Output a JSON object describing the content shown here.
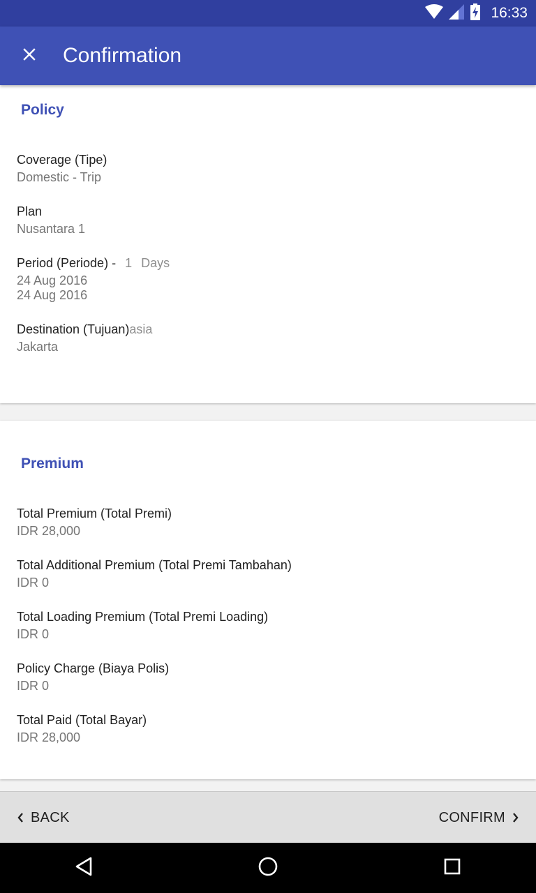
{
  "status_bar": {
    "time": "16:33"
  },
  "app_bar": {
    "title": "Confirmation"
  },
  "policy": {
    "title": "Policy",
    "coverage": {
      "label": "Coverage (Tipe)",
      "value": "Domestic - Trip"
    },
    "plan": {
      "label": "Plan",
      "value": "Nusantara 1"
    },
    "period": {
      "label": "Period (Periode) -",
      "days_count": "1",
      "days_unit": "Days",
      "start_date": "24 Aug 2016",
      "end_date": "24 Aug 2016"
    },
    "destination": {
      "label": "Destination (Tujuan)",
      "region": "asia",
      "value": "Jakarta"
    }
  },
  "premium": {
    "title": "Premium",
    "items": [
      {
        "label": "Total Premium (Total Premi)",
        "value": "IDR 28,000"
      },
      {
        "label": "Total Additional Premium (Total Premi Tambahan)",
        "value": "IDR 0"
      },
      {
        "label": "Total Loading Premium (Total Premi Loading)",
        "value": "IDR 0"
      },
      {
        "label": "Policy Charge (Biaya Polis)",
        "value": "IDR 0"
      },
      {
        "label": "Total Paid (Total Bayar)",
        "value": "IDR 28,000"
      }
    ]
  },
  "bottom_bar": {
    "back_label": "BACK",
    "confirm_label": "CONFIRM"
  },
  "colors": {
    "primary": "#3f51b5",
    "primary_dark": "#303f9f",
    "bottom_bar": "#e0e0e0"
  },
  "icons": [
    "wifi-icon",
    "signal-icon",
    "battery-charging-icon",
    "close-icon",
    "chevron-left-icon",
    "chevron-right-icon",
    "nav-back-icon",
    "nav-home-icon",
    "nav-recents-icon"
  ]
}
